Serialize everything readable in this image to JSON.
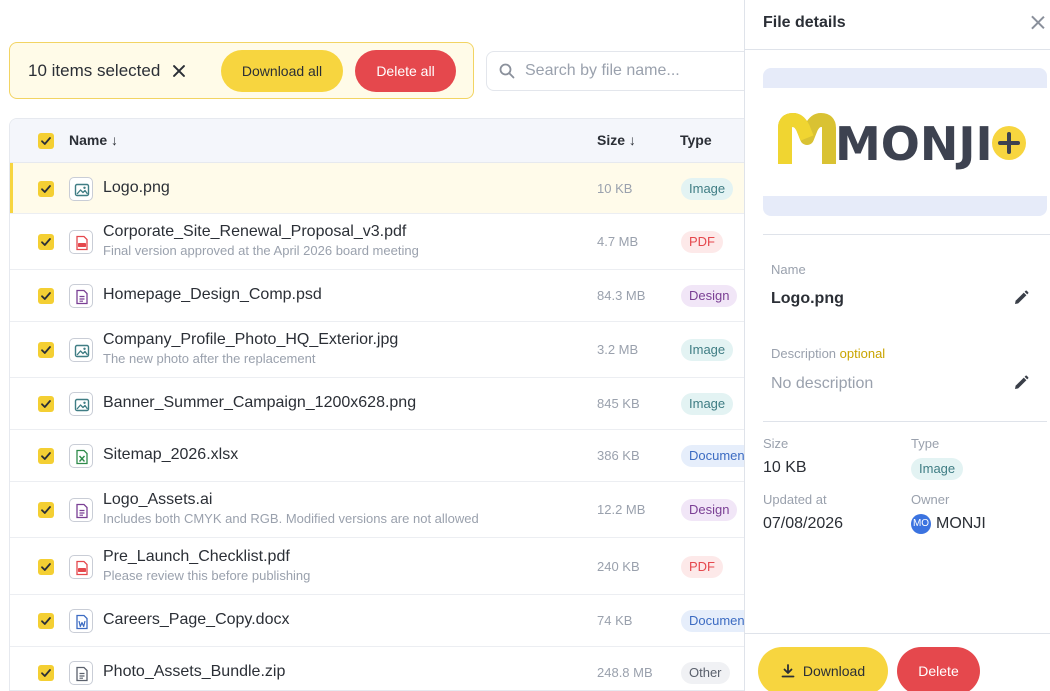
{
  "selection": {
    "count_label": "10 items selected",
    "download_all": "Download all",
    "delete_all": "Delete all"
  },
  "search": {
    "placeholder": "Search by file name..."
  },
  "table": {
    "columns": {
      "name": "Name ↓",
      "size": "Size ↓",
      "type": "Type"
    },
    "rows": [
      {
        "name": "Logo.png",
        "desc": "",
        "size": "10 KB",
        "type": "Image",
        "icon": "image-file-icon",
        "kind": "image"
      },
      {
        "name": "Corporate_Site_Renewal_Proposal_v3.pdf",
        "desc": "Final version approved at the April 2026 board meeting",
        "size": "4.7 MB",
        "type": "PDF",
        "icon": "pdf-file-icon",
        "kind": "pdf"
      },
      {
        "name": "Homepage_Design_Comp.psd",
        "desc": "",
        "size": "84.3 MB",
        "type": "Design",
        "icon": "design-file-icon",
        "kind": "design"
      },
      {
        "name": "Company_Profile_Photo_HQ_Exterior.jpg",
        "desc": "The new photo after the replacement",
        "size": "3.2 MB",
        "type": "Image",
        "icon": "image-file-icon",
        "kind": "image"
      },
      {
        "name": "Banner_Summer_Campaign_1200x628.png",
        "desc": "",
        "size": "845 KB",
        "type": "Image",
        "icon": "image-file-icon",
        "kind": "image"
      },
      {
        "name": "Sitemap_2026.xlsx",
        "desc": "",
        "size": "386 KB",
        "type": "Document",
        "icon": "spreadsheet-file-icon",
        "kind": "sheet"
      },
      {
        "name": "Logo_Assets.ai",
        "desc": "Includes both CMYK and RGB. Modified versions are not allowed",
        "size": "12.2 MB",
        "type": "Design",
        "icon": "design-file-icon",
        "kind": "design"
      },
      {
        "name": "Pre_Launch_Checklist.pdf",
        "desc": "Please review this before publishing",
        "size": "240 KB",
        "type": "PDF",
        "icon": "pdf-file-icon",
        "kind": "pdf"
      },
      {
        "name": "Careers_Page_Copy.docx",
        "desc": "",
        "size": "74 KB",
        "type": "Document",
        "icon": "word-file-icon",
        "kind": "word"
      },
      {
        "name": "Photo_Assets_Bundle.zip",
        "desc": "",
        "size": "248.8 MB",
        "type": "Other",
        "icon": "archive-file-icon",
        "kind": "other"
      }
    ]
  },
  "details": {
    "title": "File details",
    "preview_logo_text": "MONJI",
    "name_label": "Name",
    "name_value": "Logo.png",
    "description_label": "Description",
    "description_optional": "optional",
    "description_value": "No description",
    "size_label": "Size",
    "size_value": "10 KB",
    "type_label": "Type",
    "type_value": "Image",
    "updated_label": "Updated at",
    "updated_value": "07/08/2026",
    "owner_label": "Owner",
    "owner_initials": "MO",
    "owner_name": "MONJI",
    "download_label": "Download",
    "delete_label": "Delete"
  },
  "colors": {
    "accent_yellow": "#f7d53f",
    "danger_red": "#e5484d",
    "brand_grey": "#3d4250"
  }
}
